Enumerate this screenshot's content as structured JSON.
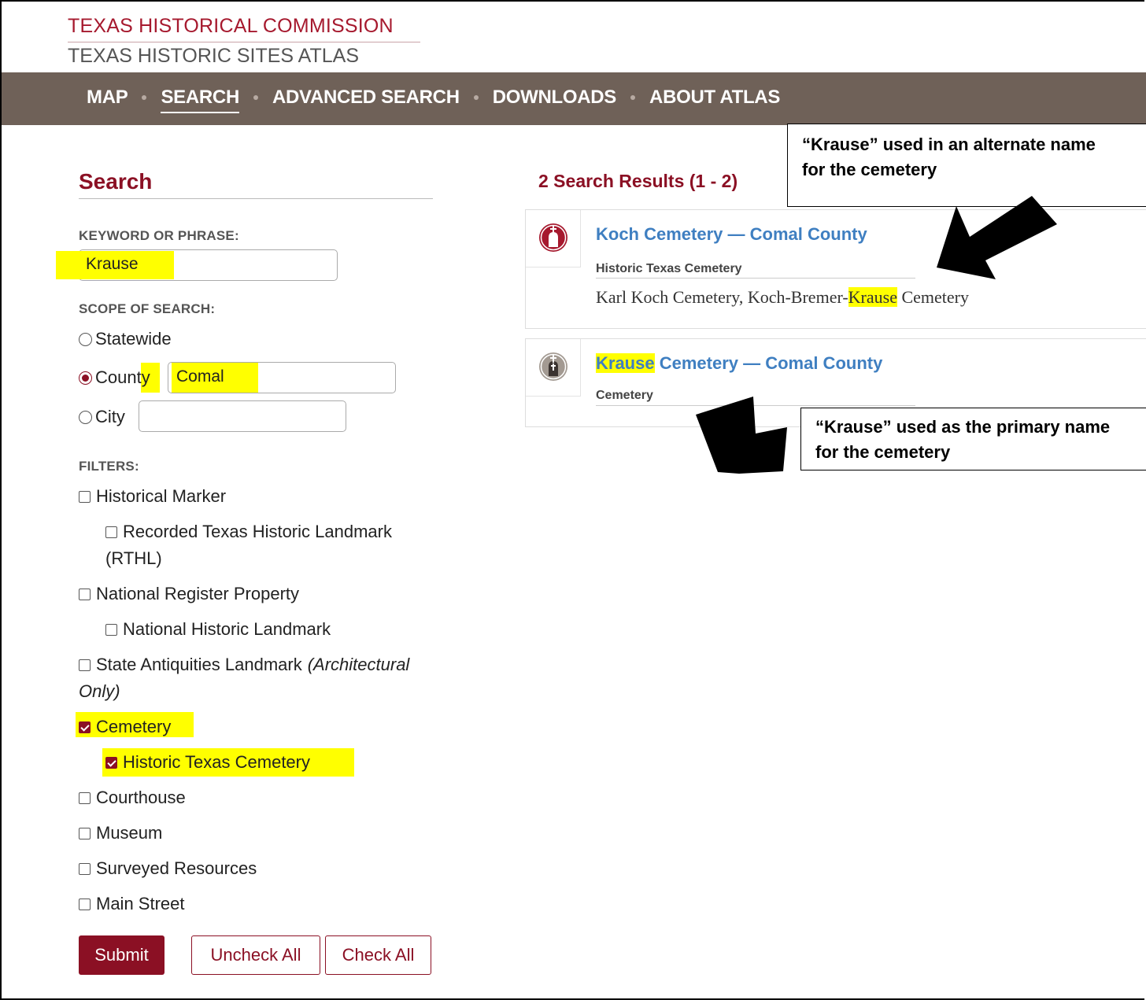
{
  "header": {
    "org": "TEXAS HISTORICAL COMMISSION",
    "site": "TEXAS HISTORIC SITES ATLAS"
  },
  "nav": {
    "items": [
      "MAP",
      "SEARCH",
      "ADVANCED SEARCH",
      "DOWNLOADS",
      "ABOUT ATLAS"
    ],
    "active": "SEARCH"
  },
  "search": {
    "title": "Search",
    "keyword_label": "KEYWORD OR PHRASE:",
    "keyword_value": "Krause",
    "scope_label": "SCOPE OF SEARCH:",
    "scope_statewide": "Statewide",
    "scope_county": "County",
    "county_value": "Comal",
    "scope_city": "City",
    "city_value": "",
    "filters_label": "FILTERS:",
    "filters": {
      "historical_marker": "Historical Marker",
      "rthl_line1": "Recorded Texas Historic Landmark",
      "rthl_line2": "(RTHL)",
      "national_register": "National Register Property",
      "national_landmark": "National Historic Landmark",
      "state_antiquities": "State Antiquities Landmark",
      "state_antiquities_note_1": "(Architectural",
      "state_antiquities_note_2": "Only)",
      "cemetery": "Cemetery",
      "historic_texas_cemetery": "Historic Texas Cemetery",
      "courthouse": "Courthouse",
      "museum": "Museum",
      "surveyed_resources": "Surveyed Resources",
      "main_street": "Main Street"
    },
    "submit_label": "Submit",
    "uncheck_all_label": "Uncheck All",
    "check_all_label": "Check All"
  },
  "results": {
    "title": "2 Search Results (1 - 2)",
    "items": [
      {
        "title": "Koch Cemetery — Comal County",
        "type": "Historic Texas Cemetery",
        "alt_before": "Karl Koch Cemetery, Koch-Bremer-",
        "alt_highlight": "Krause",
        "alt_after": " Cemetery",
        "icon": "cemetery-marker-icon-red"
      },
      {
        "title_highlight": "Krause",
        "title_rest": " Cemetery — Comal County",
        "type": "Cemetery",
        "icon": "cemetery-marker-icon-gray"
      }
    ]
  },
  "callouts": {
    "alternate_line1": "“Krause” used in an alternate name",
    "alternate_line2": "for the cemetery",
    "primary_line1": "“Krause” used as the primary name",
    "primary_line2": "for the cemetery"
  },
  "colors": {
    "brand_red": "#a6192e",
    "maroon": "#8b1024",
    "nav_bg": "#6f6158",
    "link_blue": "#3f7fc1",
    "highlight": "#ffff00"
  }
}
